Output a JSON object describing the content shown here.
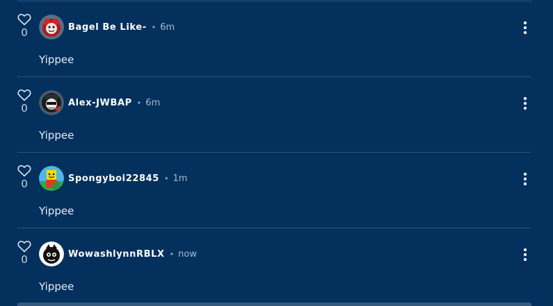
{
  "colors": {
    "background": "#03305c",
    "divider": "#2d5580",
    "text": "#e6eef7",
    "muted": "#a8bcd2"
  },
  "comments": [
    {
      "likes": "0",
      "username": "Bagel Be Like-",
      "separator": "•",
      "time": "6m",
      "text": "Yippee",
      "avatar_icon": "red-character-avatar"
    },
    {
      "likes": "0",
      "username": "Alex-JWBAP",
      "separator": "•",
      "time": "6m",
      "text": "Yippee",
      "avatar_icon": "dark-character-avatar"
    },
    {
      "likes": "0",
      "username": "Spongyboi22845",
      "separator": "•",
      "time": "1m",
      "text": "Yippee",
      "avatar_icon": "blocky-character-avatar"
    },
    {
      "likes": "0",
      "username": "WowashlynnRBLX",
      "separator": "•",
      "time": "now",
      "text": "Yippee",
      "avatar_icon": "white-character-avatar"
    }
  ]
}
